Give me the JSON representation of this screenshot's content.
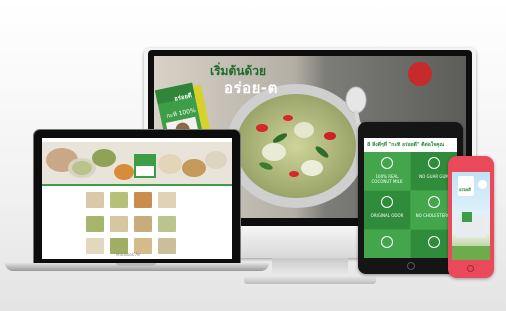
{
  "imac": {
    "headline_left": "เริ่มต้นด้วย",
    "headline_big": "อร่อย-ต",
    "product_brand": "อร่อยดี",
    "product_label": "กะทิ 100%"
  },
  "macbook": {
    "label": "MacBook Air"
  },
  "ipad": {
    "title": "8 สิ่งดีๆที่ \"กะทิ อร่อยดี\" ดีต่อใจคุณ",
    "features": [
      {
        "label": "100% REAL COCONUT MILK"
      },
      {
        "label": "NO GUAR GUM"
      },
      {
        "label": "ORIGINAL ODOR"
      },
      {
        "label": "NO CHOLESTEROL"
      }
    ]
  },
  "phone": {
    "brand": "อร่อยดี"
  },
  "colors": {
    "green": "#3e9e47",
    "dark_green": "#2d8a3a",
    "phone_red": "#e9495a"
  }
}
